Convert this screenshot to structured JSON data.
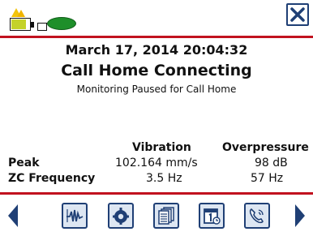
{
  "status_bar": {
    "battery_icon": "battery-charging-icon",
    "storage_icon": "storage-disk-icon",
    "close_icon": "close-icon",
    "accent_color": "#c1121f",
    "frame_color": "#1f3f75"
  },
  "header": {
    "datetime": "March 17, 2014 20:04:32",
    "title": "Call Home Connecting",
    "subtitle": "Monitoring Paused for Call Home"
  },
  "readings": {
    "columns": [
      "Vibration",
      "Overpressure"
    ],
    "rows": [
      {
        "label": "Peak",
        "vibration": "102.164 mm/s",
        "overpressure": "98 dB"
      },
      {
        "label": "ZC Frequency",
        "vibration": "3.5 Hz",
        "overpressure": "57 Hz"
      }
    ]
  },
  "nav": {
    "buttons": [
      "waveform-icon",
      "monitor-gear-icon",
      "files-icon",
      "calendar-icon",
      "phone-icon"
    ]
  }
}
